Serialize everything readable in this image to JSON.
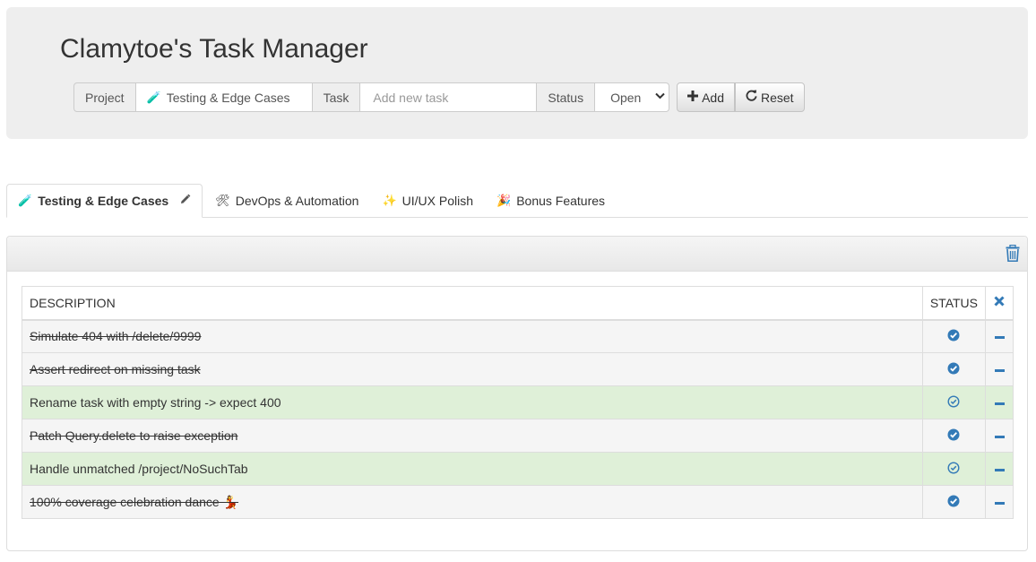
{
  "app": {
    "title": "Clamytoe's Task Manager"
  },
  "form": {
    "project_label": "Project",
    "project_emoji": "🧪",
    "project_value": "Testing & Edge Cases",
    "task_label": "Task",
    "task_placeholder": "Add new task",
    "status_label": "Status",
    "status_value": "Open",
    "add_label": "Add",
    "reset_label": "Reset"
  },
  "tabs": [
    {
      "emoji": "🧪",
      "label": "Testing & Edge Cases",
      "active": true
    },
    {
      "emoji": "🛠",
      "label": "DevOps & Automation",
      "active": false
    },
    {
      "emoji": "✨",
      "label": "UI/UX Polish",
      "active": false
    },
    {
      "emoji": "🎉",
      "label": "Bonus Features",
      "active": false
    }
  ],
  "table": {
    "headers": {
      "description": "DESCRIPTION",
      "status": "STATUS"
    },
    "rows": [
      {
        "description": "Simulate 404 with /delete/9999",
        "done": true
      },
      {
        "description": "Assert redirect on missing task",
        "done": true
      },
      {
        "description": "Rename task with empty string -> expect 400",
        "done": false
      },
      {
        "description": "Patch Query.delete to raise exception",
        "done": true
      },
      {
        "description": "Handle unmatched /project/NoSuchTab",
        "done": false
      },
      {
        "description": "100% coverage celebration dance 💃",
        "done": true
      }
    ]
  },
  "colors": {
    "accent": "#337ab7",
    "open_row": "#dff0d8",
    "done_row": "#f5f5f5"
  }
}
